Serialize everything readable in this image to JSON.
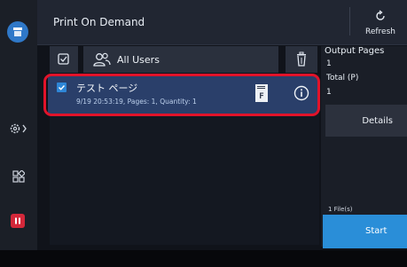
{
  "header": {
    "title": "Print On Demand",
    "refresh_label": "Refresh"
  },
  "toolbar": {
    "all_users_label": "All Users"
  },
  "jobs": [
    {
      "name": "テスト ページ",
      "meta": "9/19 20:53:19, Pages: 1, Quantity: 1",
      "file_type_letter": "F",
      "checked": true
    }
  ],
  "summary": {
    "output_pages_label": "Output Pages",
    "output_pages_value": "1",
    "total_label": "Total (P)",
    "total_value": "1",
    "details_label": "Details",
    "files_label": "1 File(s)",
    "start_label": "Start"
  },
  "colors": {
    "accent": "#2a8ed8",
    "selected_row": "#2a3f6a",
    "highlight": "#e2132a",
    "pause": "#d4283a"
  },
  "icons": [
    "home-icon",
    "gear-icon",
    "apps-icon",
    "pause-icon",
    "refresh-icon",
    "select-all-icon",
    "users-icon",
    "trash-icon",
    "checkbox-icon",
    "file-icon",
    "info-icon"
  ]
}
